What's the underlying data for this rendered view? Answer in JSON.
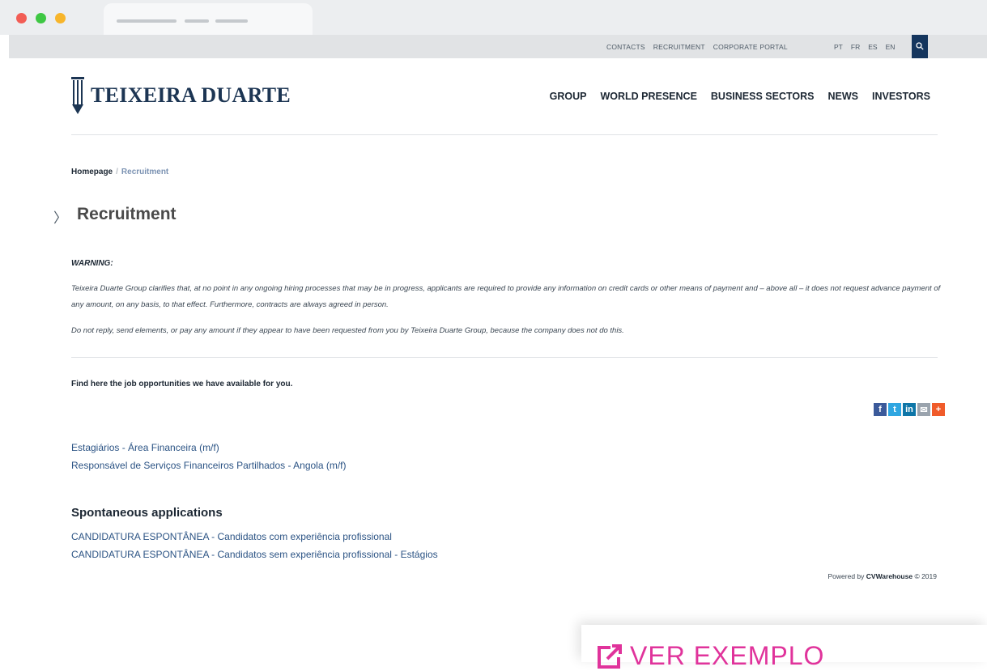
{
  "top_links": [
    "CONTACTS",
    "RECRUITMENT",
    "CORPORATE PORTAL"
  ],
  "languages": [
    "PT",
    "FR",
    "ES",
    "EN"
  ],
  "logo_text": "TEIXEIRA DUARTE",
  "nav": [
    "GROUP",
    "WORLD PRESENCE",
    "BUSINESS SECTORS",
    "NEWS",
    "INVESTORS"
  ],
  "breadcrumb": {
    "home": "Homepage",
    "separator": "/",
    "current": "Recruitment"
  },
  "chevron": "〉",
  "page_title": "Recruitment",
  "warning": {
    "heading": "WARNING:",
    "p1": "Teixeira Duarte Group clarifies that, at no point in any ongoing hiring processes that may be in progress, applicants are required to provide any information on credit cards or other means of payment and – above all – it does not request advance payment of any amount, on any basis, to that effect. Furthermore, contracts are always agreed in person.",
    "p2": "Do not reply, send elements, or pay any amount if they appear to have been requested from you by Teixeira Duarte Group, because the company does not do this."
  },
  "find_text": "Find here the job opportunities we have available for you.",
  "social": {
    "fb": "f",
    "tw": "t",
    "in": "in",
    "mail": "✉",
    "plus": "+"
  },
  "jobs": [
    "Estagiários - Área Financeira (m/f)",
    "Responsável de Serviços Financeiros Partilhados - Angola (m/f)"
  ],
  "spontaneous": {
    "heading": "Spontaneous applications",
    "links": [
      "CANDIDATURA ESPONTÂNEA - Candidatos com experiência profissional",
      "CANDIDATURA ESPONTÂNEA - Candidatos sem experiência profissional - Estágios"
    ]
  },
  "powered": {
    "prefix": "Powered by",
    "brand": "CVWarehouse",
    "suffix": "© 2019"
  },
  "cta": "VER EXEMPLO",
  "colors": {
    "accent": "#15365e",
    "link": "#2b5384",
    "cta": "#e0339b"
  }
}
